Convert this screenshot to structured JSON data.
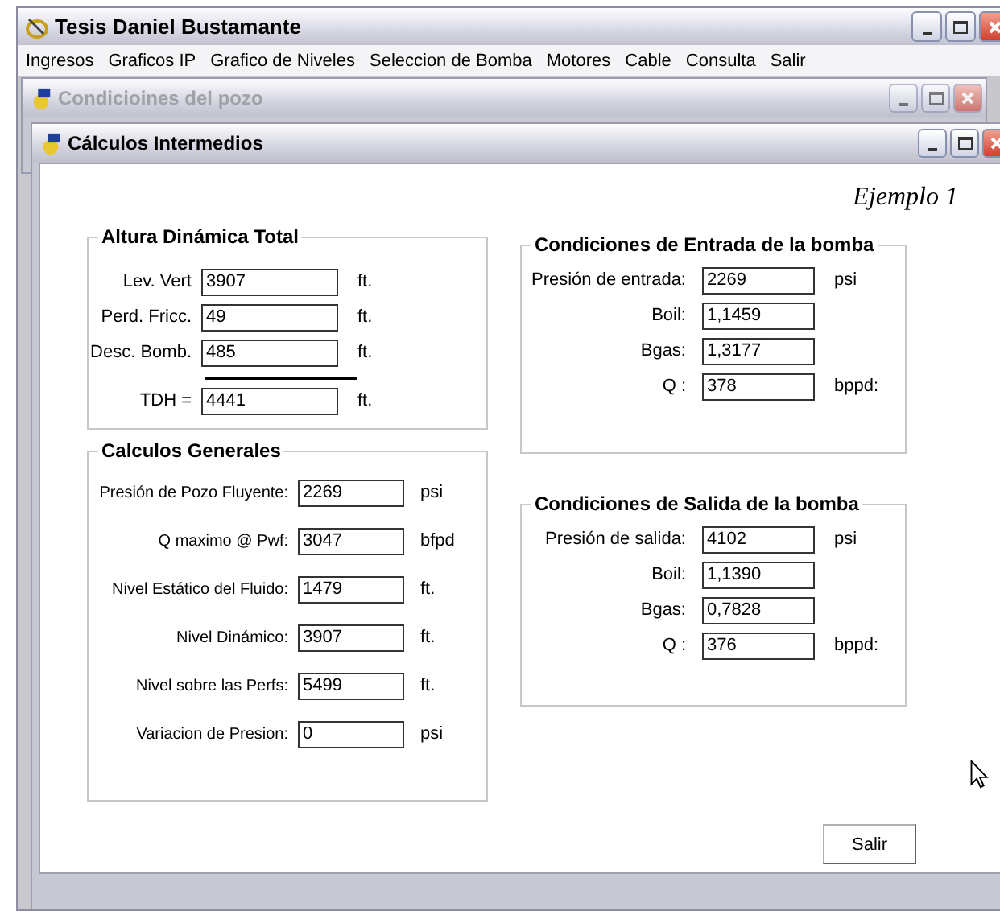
{
  "app_window": {
    "title": "Tesis Daniel Bustamante"
  },
  "menu": [
    "Ingresos",
    "Graficos IP",
    "Grafico de Niveles",
    "Seleccion de Bomba",
    "Motores",
    "Cable",
    "Consulta",
    "Salir"
  ],
  "child_windows": [
    {
      "title": "Condicioines del pozo",
      "active": false
    },
    {
      "title": "Cálculos Intermedios",
      "active": true
    }
  ],
  "example_label": "Ejemplo 1",
  "left_groups": [
    {
      "title": "Altura Dinámica Total",
      "rows": [
        {
          "kind": "field",
          "label": "Lev. Vert",
          "value": "3907",
          "unit": "ft."
        },
        {
          "kind": "field",
          "label": "Perd. Fricc.",
          "value": "49",
          "unit": "ft."
        },
        {
          "kind": "field",
          "label": "Desc. Bomb.",
          "value": "485",
          "unit": "ft."
        },
        {
          "kind": "total",
          "label": "TDH =",
          "value": "4441",
          "unit": "ft."
        }
      ]
    },
    {
      "title": "Calculos Generales",
      "rows": [
        {
          "kind": "field",
          "label": "Presión de Pozo Fluyente:",
          "value": "2269",
          "unit": "psi"
        },
        {
          "kind": "field",
          "label": "Q maximo @ Pwf:",
          "value": "3047",
          "unit": "bfpd"
        },
        {
          "kind": "field",
          "label": "Nivel Estático del Fluido:",
          "value": "1479",
          "unit": "ft."
        },
        {
          "kind": "field",
          "label": "Nivel Dinámico:",
          "value": "3907",
          "unit": "ft."
        },
        {
          "kind": "field",
          "label": "Nivel sobre las Perfs:",
          "value": "5499",
          "unit": "ft."
        },
        {
          "kind": "field",
          "label": "Variacion de Presion:",
          "value": "0",
          "unit": "psi"
        }
      ]
    }
  ],
  "right_groups": [
    {
      "title": "Condiciones de Entrada de la bomba",
      "rows": [
        {
          "kind": "field",
          "label": "Presión de entrada:",
          "value": "2269",
          "unit": "psi"
        },
        {
          "kind": "field",
          "label": "Boil:",
          "value": "1,1459"
        },
        {
          "kind": "field",
          "label": "Bgas:",
          "value": "1,3177"
        },
        {
          "kind": "field",
          "label": "Q :",
          "value": "378",
          "unit": "bppd:"
        }
      ]
    },
    {
      "title": "Condiciones de Salida de la bomba",
      "rows": [
        {
          "kind": "field",
          "label": "Presión de salida:",
          "value": "4102",
          "unit": "psi"
        },
        {
          "kind": "field",
          "label": "Boil:",
          "value": "1,1390"
        },
        {
          "kind": "field",
          "label": "Bgas:",
          "value": "0,7828"
        },
        {
          "kind": "field",
          "label": "Q :",
          "value": "376",
          "unit": "bppd:"
        }
      ]
    }
  ],
  "button": "Salir"
}
